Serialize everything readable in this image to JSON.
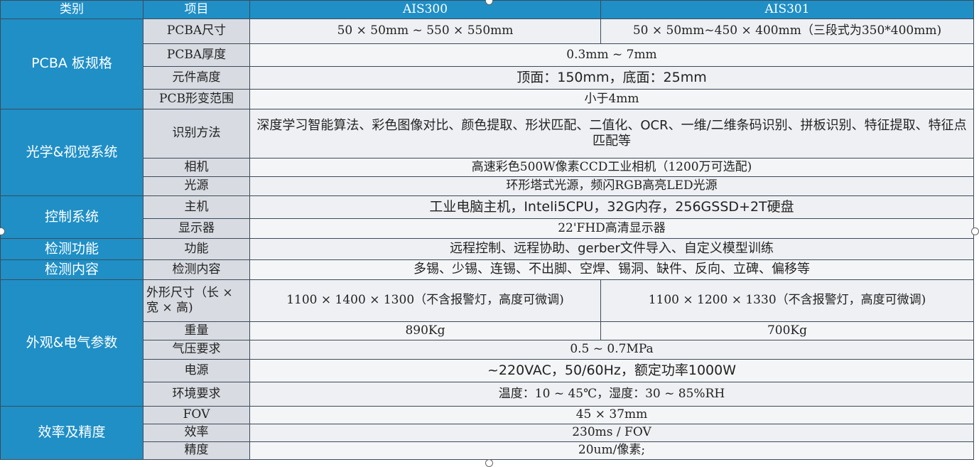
{
  "header": {
    "category": "类别",
    "item": "项目",
    "model_a": "AIS300",
    "model_b": "AIS301"
  },
  "pcba": {
    "category": "PCBA 板规格",
    "size_label": "PCBA尺寸",
    "size_a": "50 × 50mm ~ 550 × 550mm",
    "size_b": "50 × 50mm~450 × 400mm（三段式为350*400mm)",
    "thickness_label": "PCBA厚度",
    "thickness_value": "0.3mm ~ 7mm",
    "height_label": "元件高度",
    "height_value": "顶面：150mm，底面：25mm",
    "warp_label": "PCB形变范围",
    "warp_value": "小于4mm"
  },
  "optics": {
    "category": "光学&视觉系统",
    "method_label": "识别方法",
    "method_value": "深度学习智能算法、彩色图像对比、颜色提取、形状匹配、二值化、OCR、一维/二维条码识别、拼板识别、特征提取、特征点匹配等",
    "camera_label": "相机",
    "camera_value": "高速彩色500W像素CCD工业相机（1200万可选配)",
    "light_label": "光源",
    "light_value": "环形塔式光源，频闪RGB高亮LED光源"
  },
  "control": {
    "category": "控制系统",
    "host_label": "主机",
    "host_value": "工业电脑主机，Inteli5CPU，32G内存，256GSSD+2T硬盘",
    "display_label": "显示器",
    "display_value": "22'FHD高清显示器"
  },
  "function": {
    "category": "检测功能",
    "label": "功能",
    "value": "远程控制、远程协助、gerber文件导入、自定义模型训练"
  },
  "content": {
    "category": "检测内容",
    "label": "检测内容",
    "value": "多锡、少锡、连锡、不出脚、空焊、锡洞、缺件、反向、立碑、偏移等"
  },
  "appearance": {
    "category": "外观&电气参数",
    "dims_label": "外形尺寸（长 × 宽 × 高)",
    "dims_a": "1100 × 1400 × 1300（不含报警灯，高度可微调)",
    "dims_b": "1100 × 1200 × 1330（不含报警灯，高度可微调)",
    "weight_label": "重量",
    "weight_a": "890Kg",
    "weight_b": "700Kg",
    "air_label": "气压要求",
    "air_value": "0.5 ~ 0.7MPa",
    "power_label": "电源",
    "power_value": "~220VAC，50/60Hz，额定功率1000W",
    "env_label": "环境要求",
    "env_value": "温度：10 ~ 45℃，湿度：30 ~ 85%RH"
  },
  "efficiency": {
    "category": "效率及精度",
    "fov_label": "FOV",
    "fov_value": "45 × 37mm",
    "eff_label": "效率",
    "eff_value": "230ms / FOV",
    "acc_label": "精度",
    "acc_value": "20um/像素;"
  }
}
